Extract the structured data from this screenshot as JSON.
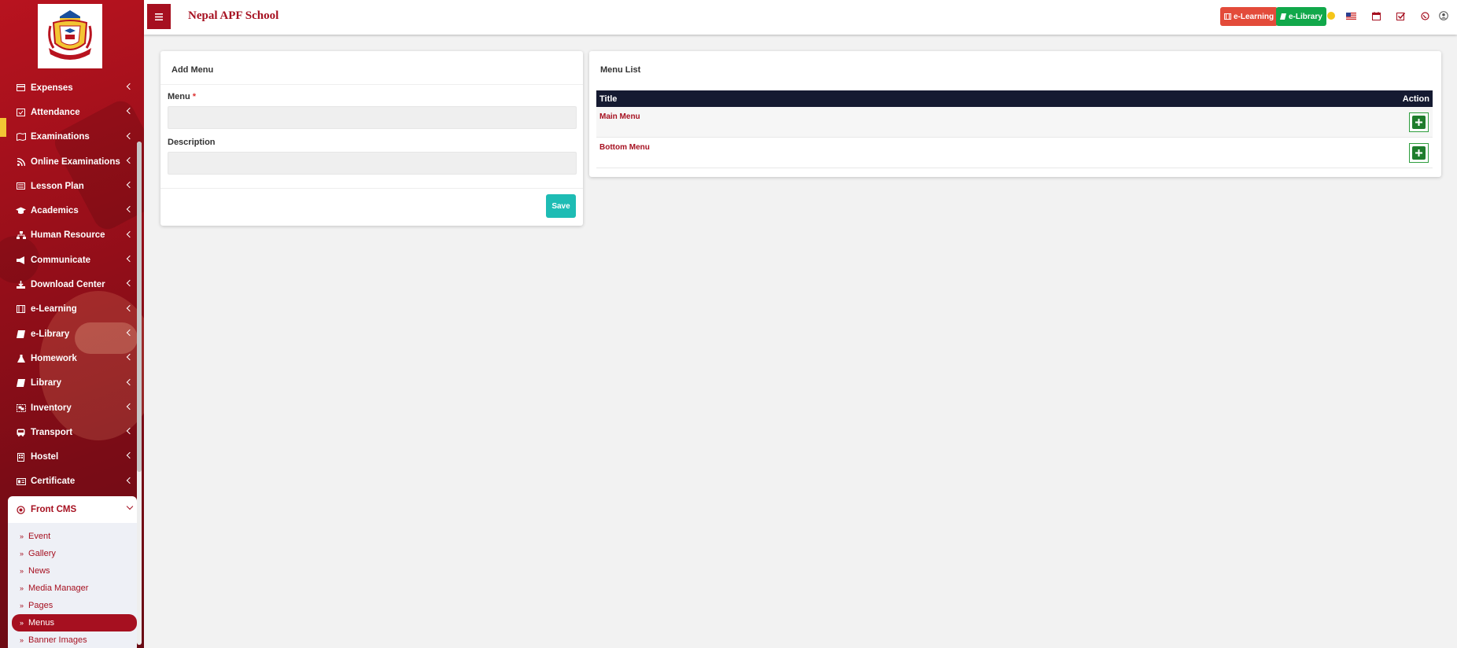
{
  "header": {
    "school_name": "Nepal APF School",
    "elearning_label": "e-Learning",
    "elibrary_label": "e-Library"
  },
  "sidebar": {
    "items": [
      {
        "label": "Expenses",
        "icon": "credit-card-icon"
      },
      {
        "label": "Attendance",
        "icon": "calendar-check-icon"
      },
      {
        "label": "Examinations",
        "icon": "map-icon"
      },
      {
        "label": "Online Examinations",
        "icon": "rss-icon"
      },
      {
        "label": "Lesson Plan",
        "icon": "list-alt-icon"
      },
      {
        "label": "Academics",
        "icon": "graduation-cap-icon"
      },
      {
        "label": "Human Resource",
        "icon": "sitemap-icon"
      },
      {
        "label": "Communicate",
        "icon": "bullhorn-icon"
      },
      {
        "label": "Download Center",
        "icon": "download-icon"
      },
      {
        "label": "e-Learning",
        "icon": "film-icon"
      },
      {
        "label": "e-Library",
        "icon": "book-icon"
      },
      {
        "label": "Homework",
        "icon": "flask-icon"
      },
      {
        "label": "Library",
        "icon": "book-icon"
      },
      {
        "label": "Inventory",
        "icon": "object-group-icon"
      },
      {
        "label": "Transport",
        "icon": "bus-icon"
      },
      {
        "label": "Hostel",
        "icon": "building-icon"
      },
      {
        "label": "Certificate",
        "icon": "id-card-icon"
      }
    ],
    "open_section": {
      "label": "Front CMS",
      "icon": "empire-icon"
    },
    "subitems": [
      "Event",
      "Gallery",
      "News",
      "Media Manager",
      "Pages",
      "Menus",
      "Banner Images"
    ],
    "active_subitem": "Menus"
  },
  "add_menu": {
    "title": "Add Menu",
    "menu_label": "Menu",
    "required_mark": "*",
    "menu_value": "",
    "description_label": "Description",
    "description_value": "",
    "save_label": "Save"
  },
  "menu_list": {
    "title": "Menu List",
    "columns": [
      "Title",
      "Action"
    ],
    "rows": [
      {
        "title": "Main Menu"
      },
      {
        "title": "Bottom Menu"
      }
    ]
  },
  "colors": {
    "brand": "#a61020",
    "elearning": "#e34b3a",
    "elibrary": "#11a84a",
    "save": "#1ebcb4",
    "table_header": "#151a31",
    "add_action": "#1f7d2d"
  }
}
